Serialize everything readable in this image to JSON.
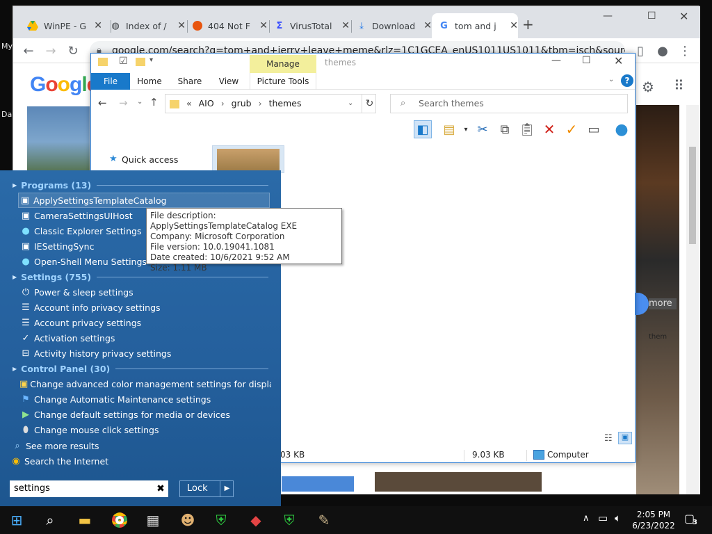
{
  "desktop": {
    "label_my": "My",
    "label_da": "Da"
  },
  "chrome": {
    "tabs": [
      {
        "title": "WinPE - G",
        "icon": "drive-icon",
        "color": "#188038"
      },
      {
        "title": "Index of /",
        "icon": "globe-icon",
        "color": "#5f6368"
      },
      {
        "title": "404 Not F",
        "icon": "firefox-icon",
        "color": "#e8550e"
      },
      {
        "title": "VirusTotal",
        "icon": "virustotal-icon",
        "color": "#394eff"
      },
      {
        "title": "Download",
        "icon": "download-icon",
        "color": "#1a73e8"
      },
      {
        "title": "tom and j",
        "icon": "google-icon",
        "color": "#4285f4"
      }
    ],
    "url": "google.com/search?q=tom+and+jerry+leave+meme&rlz=1C1GCEA_enUS1011US1011&tbm=isch&source...",
    "google_logo": "Google"
  },
  "page_misc": {
    "more_label": "more",
    "them_label": "them"
  },
  "explorer": {
    "window_title": "themes",
    "ribbon_tabs": [
      "File",
      "Home",
      "Share",
      "View",
      "Picture Tools"
    ],
    "manage_label": "Manage",
    "breadcrumb": [
      "AIO",
      "grub",
      "themes"
    ],
    "search_placeholder": "Search themes",
    "nav_quick_access": "Quick access",
    "status": {
      "size1": "03 KB",
      "size2": "9.03 KB",
      "location": "Computer"
    }
  },
  "start_menu": {
    "sections": [
      {
        "title": "Programs (13)",
        "items": [
          {
            "label": "ApplySettingsTemplateCatalog",
            "icon": "app-window-icon"
          },
          {
            "label": "CameraSettingsUIHost",
            "icon": "app-window-icon"
          },
          {
            "label": "Classic Explorer Settings",
            "icon": "shell-icon"
          },
          {
            "label": "IESettingSync",
            "icon": "app-window-icon"
          },
          {
            "label": "Open-Shell Menu Settings",
            "icon": "shell-icon"
          }
        ]
      },
      {
        "title": "Settings (755)",
        "items": [
          {
            "label": "Power & sleep settings",
            "icon": "power-icon"
          },
          {
            "label": "Account info privacy settings",
            "icon": "account-list-icon"
          },
          {
            "label": "Account privacy settings",
            "icon": "account-list-icon"
          },
          {
            "label": "Activation settings",
            "icon": "check-circle-icon"
          },
          {
            "label": "Activity history privacy settings",
            "icon": "activity-history-icon"
          }
        ]
      },
      {
        "title": "Control Panel (30)",
        "items": [
          {
            "label": "Change advanced color management settings for displays, sca...",
            "icon": "color-mgmt-icon"
          },
          {
            "label": "Change Automatic Maintenance settings",
            "icon": "flag-icon"
          },
          {
            "label": "Change default settings for media or devices",
            "icon": "autoplay-icon"
          },
          {
            "label": "Change mouse click settings",
            "icon": "mouse-icon"
          }
        ]
      }
    ],
    "see_more": "See more results",
    "search_internet": "Search the Internet",
    "search_value": "settings",
    "lock_label": "Lock"
  },
  "tooltip": {
    "lines": [
      "File description: ApplySettingsTemplateCatalog EXE",
      "Company: Microsoft Corporation",
      "File version: 10.0.19041.1081",
      "Date created: 10/6/2021 9:52 AM",
      "Size: 1.11 MB"
    ]
  },
  "taskbar": {
    "time": "2:05 PM",
    "date": "6/23/2022",
    "notif_count": "3"
  }
}
